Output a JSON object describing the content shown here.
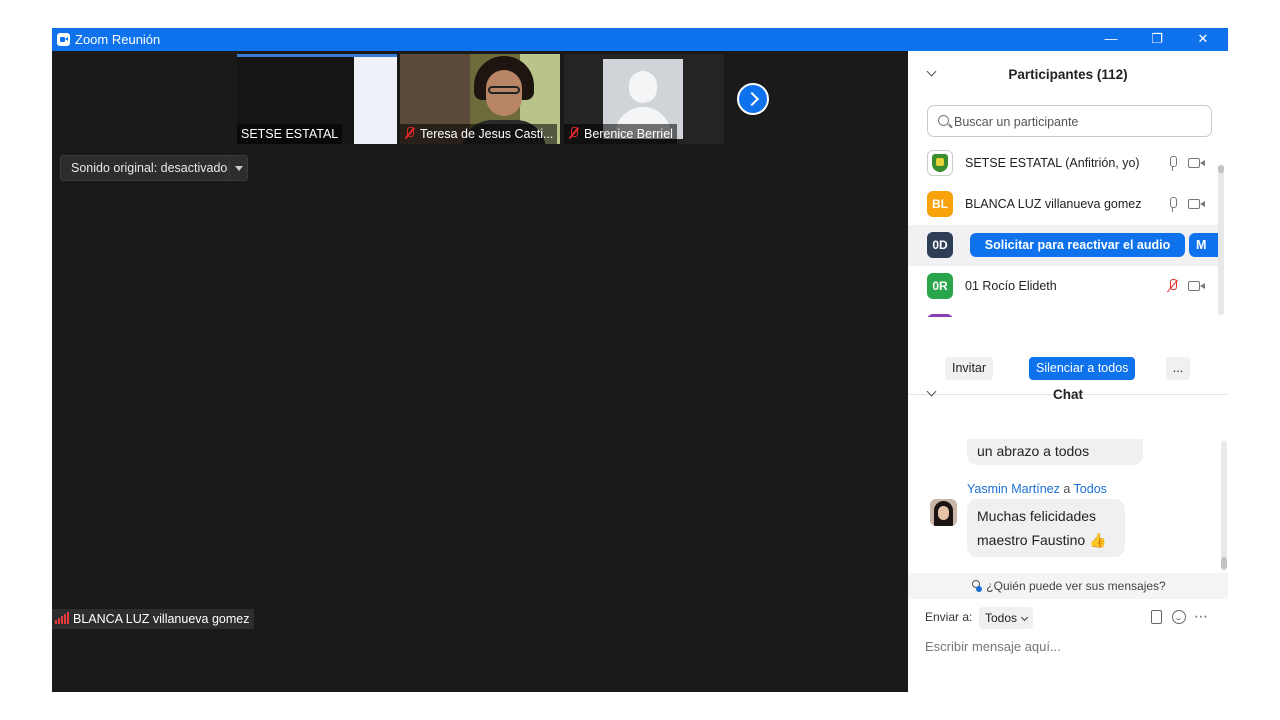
{
  "window": {
    "title": "Zoom Reunión",
    "controls": {
      "minimize": "—",
      "restore": "❐",
      "close": "✕"
    }
  },
  "video": {
    "thumbnails": [
      {
        "name": "SETSE ESTATAL",
        "muted": false
      },
      {
        "name": "Teresa de Jesus Casti...",
        "muted": true
      },
      {
        "name": "Berenice Berriel",
        "muted": true
      }
    ],
    "original_sound_label": "Sonido original: desactivado",
    "active_speaker": "BLANCA LUZ villanueva gomez"
  },
  "participants": {
    "title": "Participantes (112)",
    "search_placeholder": "Buscar un participante",
    "list": [
      {
        "initials": "",
        "name": "SETSE ESTATAL (Anfitrión, yo)",
        "color": "#ffffff",
        "mic": "on"
      },
      {
        "initials": "BL",
        "name": "BLANCA LUZ villanueva gomez",
        "color": "#f7a20a",
        "mic": "on"
      },
      {
        "initials": "0D",
        "name": "",
        "color": "#2e3e57",
        "mic": "hidden"
      },
      {
        "initials": "0R",
        "name": "01 Rocío Elideth",
        "color": "#2aa54b",
        "mic": "off"
      }
    ],
    "unmute_request_label": "Solicitar para reactivar el audio",
    "more_label": "M",
    "invite_label": "Invitar",
    "mute_all_label": "Silenciar a todos",
    "more_options_label": "..."
  },
  "chat": {
    "title": "Chat",
    "messages": [
      {
        "text": "un abrazo a todos"
      },
      {
        "sender": "Yasmin Martínez",
        "connector": "a",
        "recipient": "Todos",
        "text": "Muchas felicidades maestro Faustino",
        "emoji": "👍"
      }
    ],
    "who_can_see": "¿Quién puede ver sus mensajes?",
    "send_to_label": "Enviar a:",
    "send_to_value": "Todos",
    "input_placeholder": "Escribir mensaje aquí...",
    "more_icon": "⋯"
  },
  "colors": {
    "accent": "#0e72ed",
    "video_bg": "#1a1a1a",
    "muted_red": "#e02828"
  }
}
